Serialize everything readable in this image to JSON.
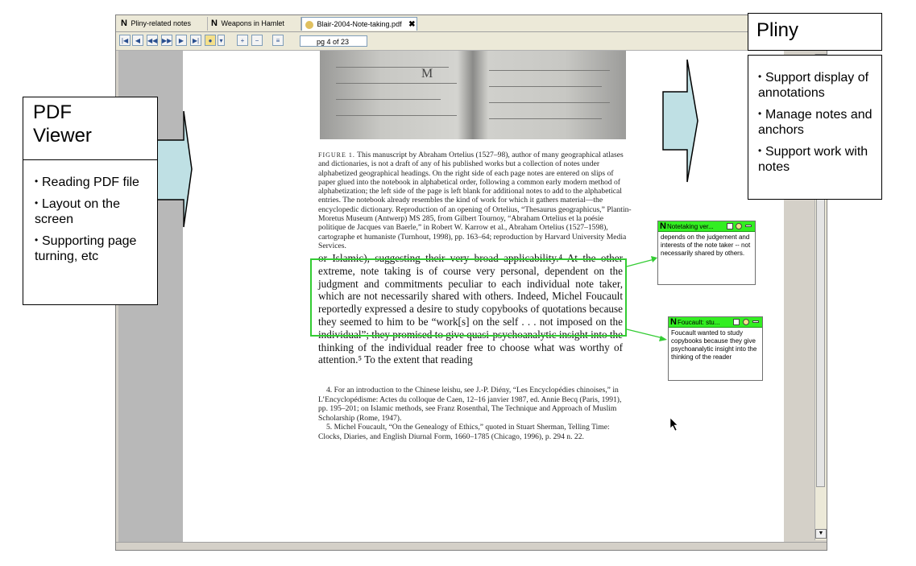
{
  "tabs": [
    {
      "label": "Pliny-related notes",
      "icon": "note-n-icon"
    },
    {
      "label": "Weapons in Hamlet",
      "icon": "note-n-icon"
    },
    {
      "label": "Blair-2004-Note-taking.pdf",
      "icon": "pdf-icon",
      "close": "✖"
    }
  ],
  "toolbar": {
    "page_indicator": "pg 4 of 23",
    "buttons": [
      "first-page",
      "prev-page",
      "rewind",
      "fast-forward",
      "next-page",
      "last-page",
      "annotate",
      "zoom-in",
      "zoom-out",
      "layout"
    ]
  },
  "document": {
    "scan_mark": "M",
    "caption_label": "FIGURE 1.",
    "caption": "This manuscript by Abraham Ortelius (1527–98), author of many geographical atlases and dictionaries, is not a draft of any of his published works but a collection of notes under alphabetized geographical headings. On the right side of each page notes are entered on slips of paper glued into the notebook in alphabetical order, following a common early modern method of alphabetization; the left side of the page is left blank for additional notes to add to the alphabetical entries. The notebook already resembles the kind of work for which it gathers material—the encyclopedic dictionary. Reproduction of an opening of Ortelius, “Thesaurus geographicus,” Plantin-Moretus Museum (Antwerp) MS 285, from Gilbert Tournoy, “Abraham Ortelius et la poésie politique de Jacques van Baerle,” in Robert W. Karrow et al., Abraham Ortelius (1527–1598), cartographe et humaniste (Turnhout, 1998), pp. 163–64; reproduction by Harvard University Media Services.",
    "body": "or Islamic), suggesting their very broad applicability.⁴ At the other extreme, note taking is of course very personal, dependent on the judgment and commitments peculiar to each individual note taker, which are not necessarily shared with others. Indeed, Michel Foucault reportedly expressed a desire to study copybooks of quotations because they seemed to him to be “work[s] on the self . . . not imposed on the individual”; they promised to give quasi-psychoanalytic insight into the thinking of the individual reader free to choose what was worthy of attention.⁵ To the extent that reading",
    "footnotes": [
      "4. For an introduction to the Chinese leishu, see J.-P. Diény, “Les Encyclopédies chinoises,” in L’Encyclopédisme: Actes du colloque de Caen, 12–16 janvier 1987, ed. Annie Becq (Paris, 1991), pp. 195–201; on Islamic methods, see Franz Rosenthal, The Technique and Approach of Muslim Scholarship (Rome, 1947).",
      "5. Michel Foucault, “On the Genealogy of Ethics,” quoted in Stuart Sherman, Telling Time: Clocks, Diaries, and English Diurnal Form, 1660–1785 (Chicago, 1996), p. 294 n. 22."
    ]
  },
  "notes": [
    {
      "title": "Notetaking ver...",
      "body": "depends on the judgement and interests of the note taker -- not necessarily shared by others."
    },
    {
      "title": "Foucault: stu...",
      "body": "Foucault wanted to study copybooks because they give psychoanalytic insight into the thinking of the reader"
    }
  ],
  "callouts": {
    "pdf_viewer": {
      "title": "PDF Viewer",
      "items": [
        "Reading PDF file",
        "Layout on the screen",
        "Supporting page turning, etc"
      ]
    },
    "pliny": {
      "title": "Pliny",
      "items": [
        "Support display of annotations",
        "Manage notes and anchors",
        "Support work with notes"
      ]
    }
  },
  "colors": {
    "highlight": "#33cc33",
    "note_header": "#33ee22",
    "arrow_fill": "#bfe0e4"
  }
}
